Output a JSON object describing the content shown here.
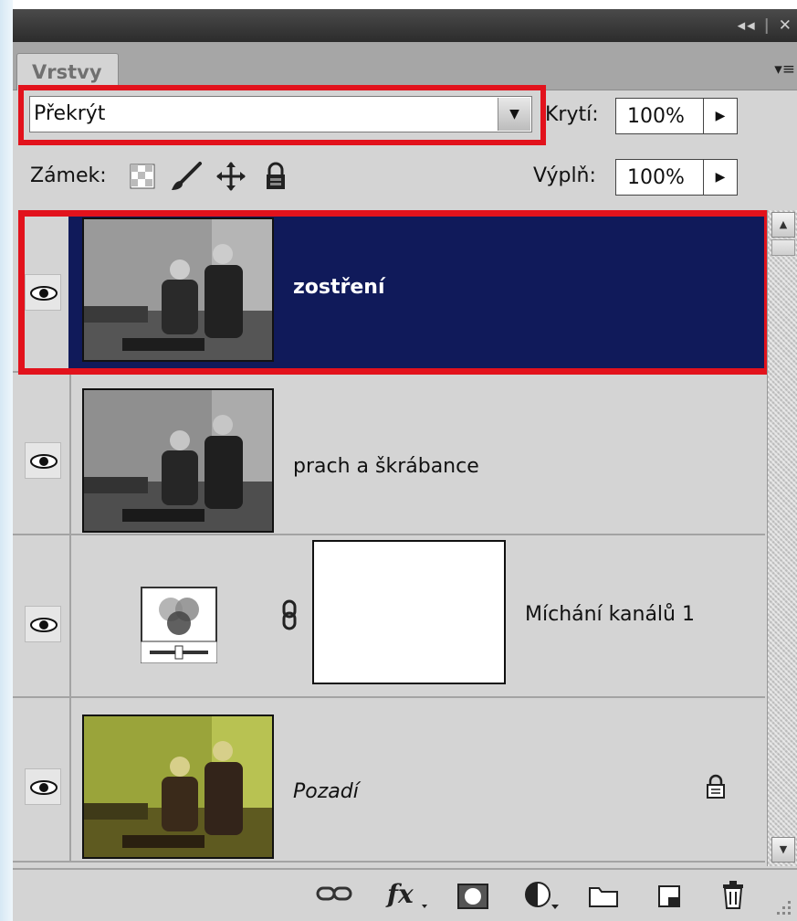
{
  "panel": {
    "tab_label": "Vrstvy",
    "menu_icon": "panel-menu-icon",
    "collapse_icon": "double-arrow-left-icon",
    "close_icon": "close-icon"
  },
  "blend": {
    "mode": "Překrýt",
    "opacity_label": "Krytí:",
    "opacity_value": "100%",
    "fill_label": "Výplň:",
    "fill_value": "100%",
    "lock_label": "Zámek:"
  },
  "layers": [
    {
      "name": "zostření",
      "selected": true,
      "type": "pixel"
    },
    {
      "name": "prach a škrábance",
      "selected": false,
      "type": "pixel"
    },
    {
      "name": "Míchání kanálů 1",
      "selected": false,
      "type": "adjustment"
    },
    {
      "name": "Pozadí",
      "selected": false,
      "type": "background",
      "locked": true
    }
  ],
  "footer_icons": [
    "link-layers-icon",
    "fx-icon",
    "mask-icon",
    "adjustment-icon",
    "group-folder-icon",
    "new-layer-icon",
    "trash-icon"
  ],
  "colors": {
    "selection": "#101a5a",
    "highlight_outline": "#e2121c",
    "panel_bg": "#d4d4d4"
  }
}
